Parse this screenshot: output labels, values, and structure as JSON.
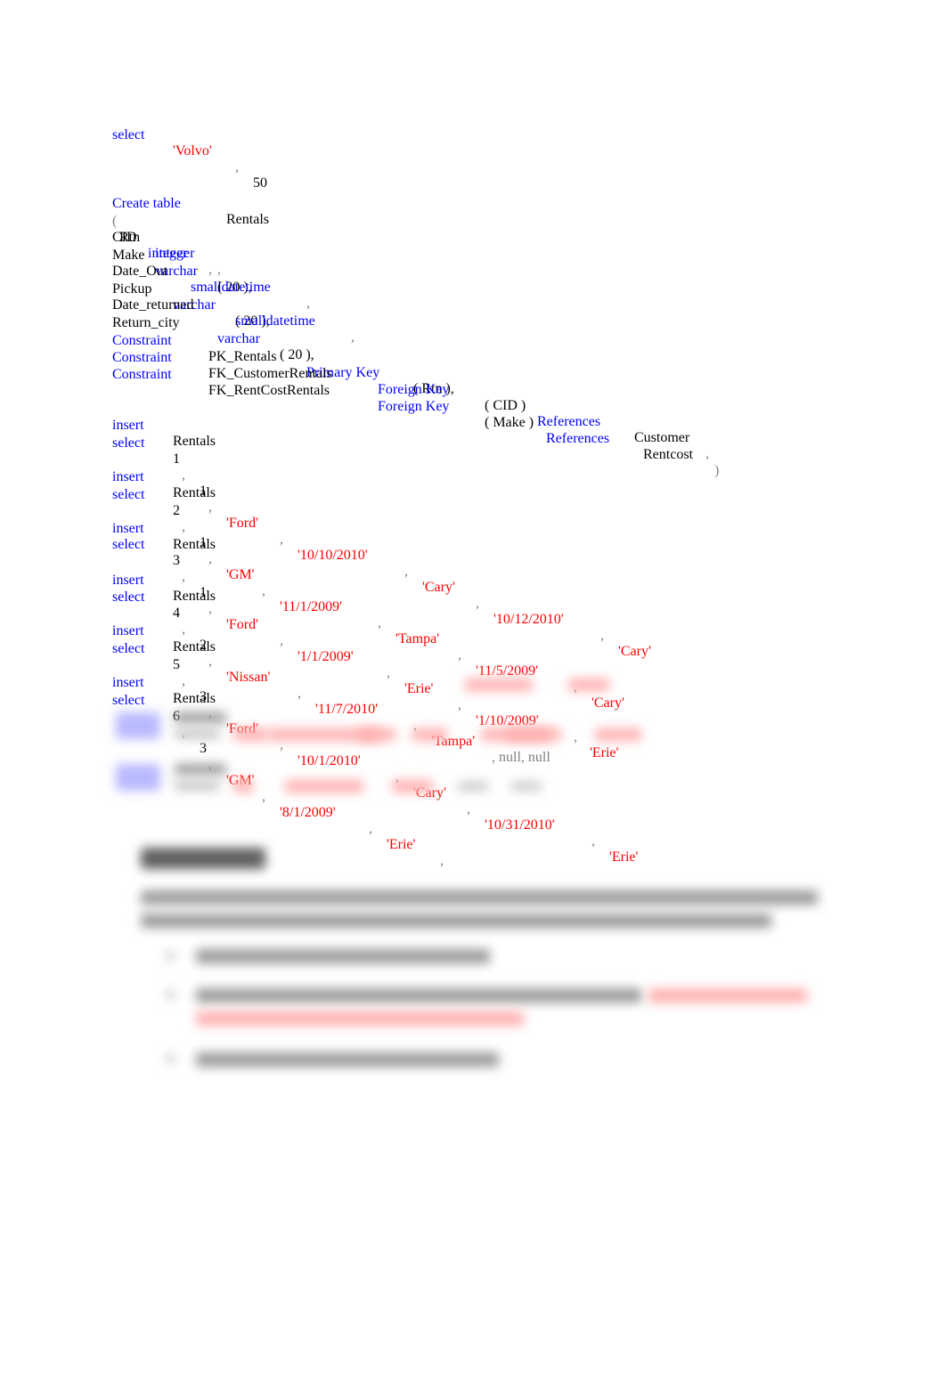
{
  "select_volvo": {
    "kw": "select",
    "value1": "'Volvo'",
    "comma": ",",
    "value2": "50"
  },
  "create_table": {
    "kw": "Create table",
    "name": "Rentals",
    "columns": [
      {
        "open": "(",
        "name": "Rtn",
        "type": "integer",
        "size": "",
        "sep": ","
      },
      {
        "open": "",
        "name": "CID",
        "type": "integer",
        "size": "",
        "sep": ","
      },
      {
        "open": "",
        "name": "Make",
        "type": "varchar",
        "size": "( 20 ),",
        "sep": ""
      },
      {
        "open": "",
        "name": "Date_Out",
        "type": "smalldatetime",
        "size": "",
        "sep": ","
      },
      {
        "open": "",
        "name": "Pickup",
        "type": "varchar",
        "size": "( 20 ),",
        "sep": ""
      },
      {
        "open": "",
        "name": "Date_returned",
        "type": "smalldatetime",
        "size": "",
        "sep": ","
      },
      {
        "open": "",
        "name": "Return_city",
        "type": "varchar",
        "size": "( 20 ),",
        "sep": ""
      }
    ],
    "constraints": [
      {
        "kw": "Constraint",
        "name": "PK_Rentals",
        "key": "Primary Key",
        "col": "( Rtn ),",
        "ref_kw": "",
        "ref_table": "",
        "end": ""
      },
      {
        "kw": "Constraint",
        "name": "FK_CustomerRentals",
        "key": "Foreign Key",
        "col": "( CID )",
        "ref_kw": "References",
        "ref_table": "Customer",
        "end": ","
      },
      {
        "kw": "Constraint",
        "name": "FK_RentCostRentals",
        "key": "Foreign Key",
        "col": "( Make )",
        "ref_kw": "References",
        "ref_table": "Rentcost",
        "end": ")"
      }
    ]
  },
  "inserts": [
    {
      "insert_kw": "insert",
      "table": "Rentals",
      "select_kw": "select",
      "rtn": "1",
      "cid": "1",
      "make": "'Ford'",
      "date_out": "'10/10/2010'",
      "pickup": "'Cary'",
      "date_returned": "'10/12/2010'",
      "return_city": "'Cary'"
    },
    {
      "insert_kw": "insert",
      "table": "Rentals",
      "select_kw": "select",
      "rtn": "2",
      "cid": "1",
      "make": "'GM'",
      "date_out": "'11/1/2009'",
      "pickup": "'Tampa'",
      "date_returned": "'11/5/2009'",
      "return_city": "'Cary'"
    },
    {
      "insert_kw": "insert",
      "table": "Rentals",
      "select_kw": "select",
      "rtn": "3",
      "cid": "1",
      "make": "'Ford'",
      "date_out": "'1/1/2009'",
      "pickup": "'Erie'",
      "date_returned": "'1/10/2009'",
      "return_city": "'Erie'"
    },
    {
      "insert_kw": "insert",
      "table": "Rentals",
      "select_kw": "select",
      "rtn": "4",
      "cid": "2",
      "make": "'Nissan'",
      "date_out": "'11/7/2010'",
      "pickup": "'Tampa'",
      "null_tail": ", null, null"
    },
    {
      "insert_kw": "insert",
      "table": "Rentals",
      "select_kw": "select",
      "rtn": "5",
      "cid": "3",
      "make": "'Ford'",
      "date_out": "'10/1/2010'",
      "pickup": "'Cary'",
      "date_returned": "'10/31/2010'",
      "return_city": "'Erie'"
    },
    {
      "insert_kw": "insert",
      "table": "Rentals",
      "select_kw": "select",
      "rtn": "6",
      "cid": "3",
      "make": "'GM'",
      "date_out": "'8/1/2009'",
      "pickup": "'Erie'"
    }
  ],
  "punct": {
    "comma": ","
  }
}
